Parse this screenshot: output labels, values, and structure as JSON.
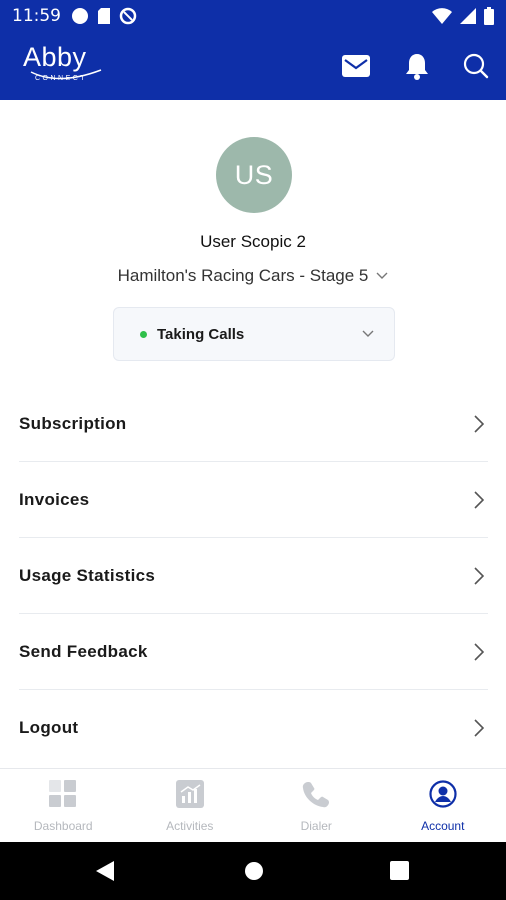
{
  "status_bar": {
    "time": "11:59",
    "left_icons": [
      "circle-icon",
      "sim-icon",
      "data-saver-icon"
    ],
    "right_icons": [
      "wifi-icon",
      "signal-icon",
      "battery-icon"
    ]
  },
  "app_bar": {
    "logo_text": "Abby",
    "logo_subtext": "CONNECT",
    "icons": [
      "mail-icon",
      "bell-icon",
      "search-icon"
    ],
    "bg_color": "#0e2fa8"
  },
  "profile": {
    "initials": "US",
    "name": "User Scopic 2",
    "company": "Hamilton's Racing Cars - Stage 5",
    "avatar_color": "#9db8ab"
  },
  "call_status": {
    "label": "Taking Calls",
    "dot_color": "#2fc04a"
  },
  "menu": {
    "items": [
      {
        "label": "Subscription"
      },
      {
        "label": "Invoices"
      },
      {
        "label": "Usage Statistics"
      },
      {
        "label": "Send Feedback"
      },
      {
        "label": "Logout"
      }
    ]
  },
  "bottom_nav": {
    "items": [
      {
        "label": "Dashboard",
        "icon": "dashboard-icon",
        "active": false
      },
      {
        "label": "Activities",
        "icon": "activities-icon",
        "active": false
      },
      {
        "label": "Dialer",
        "icon": "phone-icon",
        "active": false
      },
      {
        "label": "Account",
        "icon": "account-icon",
        "active": true
      }
    ],
    "active_color": "#0e2fa8",
    "inactive_color": "#b5b8bd"
  },
  "system_nav": {
    "icons": [
      "back-icon",
      "home-icon",
      "recents-icon"
    ]
  }
}
